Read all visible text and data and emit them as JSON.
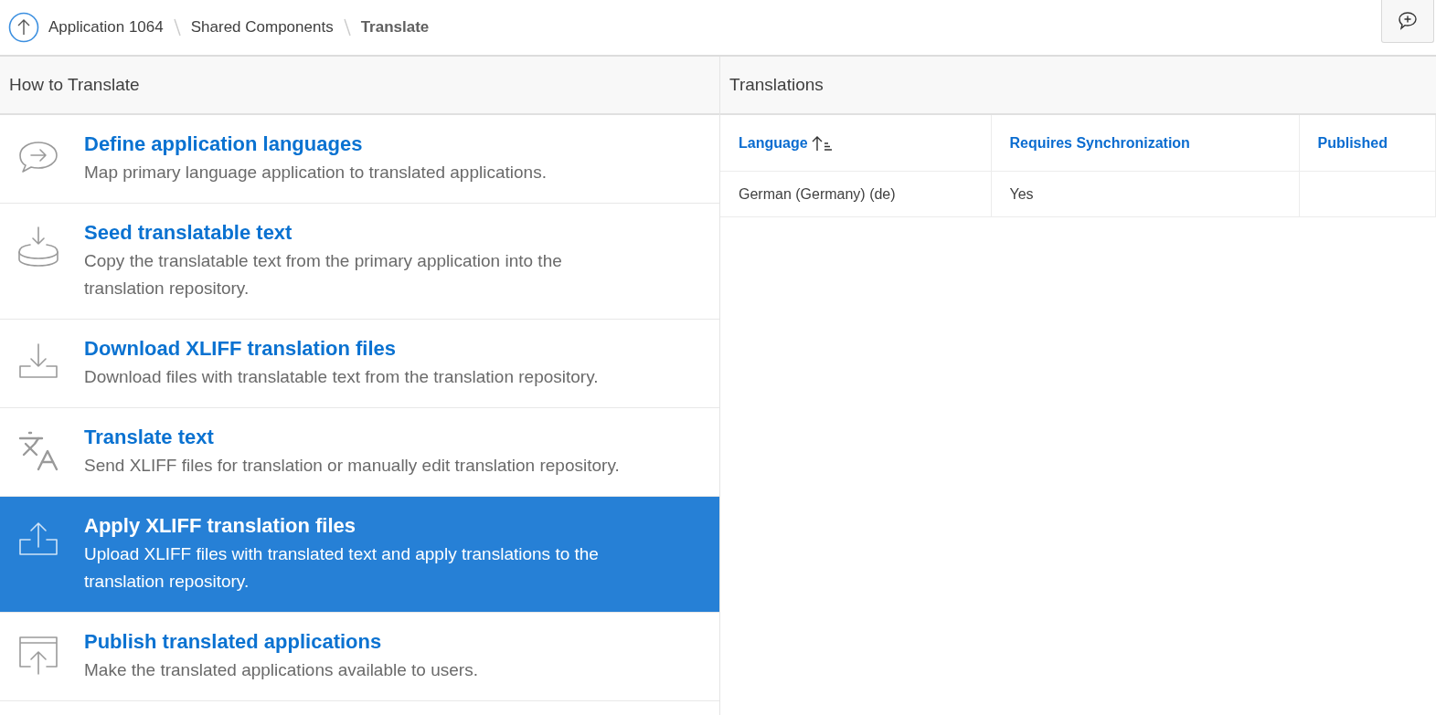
{
  "breadcrumb": {
    "items": [
      {
        "label": "Application 1064",
        "current": false
      },
      {
        "label": "Shared Components",
        "current": false
      },
      {
        "label": "Translate",
        "current": true
      }
    ]
  },
  "how_to": {
    "title": "How to Translate",
    "items": [
      {
        "kind": "chat-arrow",
        "title": "Define application languages",
        "description": "Map primary language application to translated applications.",
        "selected": false
      },
      {
        "kind": "disk-download",
        "title": "Seed translatable text",
        "description": "Copy the translatable text from the primary application into the translation repository.",
        "selected": false
      },
      {
        "kind": "tray-download",
        "title": "Download XLIFF translation files",
        "description": "Download files with translatable text from the translation repository.",
        "selected": false
      },
      {
        "kind": "translate",
        "title": "Translate text",
        "description": "Send XLIFF files for translation or manually edit translation repository.",
        "selected": false
      },
      {
        "kind": "tray-upload",
        "title": "Apply XLIFF translation files",
        "description": "Upload XLIFF files with translated text and apply translations to the translation repository.",
        "selected": true
      },
      {
        "kind": "window-upload",
        "title": "Publish translated applications",
        "description": "Make the translated applications available to users.",
        "selected": false
      }
    ]
  },
  "translations": {
    "title": "Translations",
    "columns": [
      {
        "label": "Language",
        "sorted": true
      },
      {
        "label": "Requires Synchronization",
        "sorted": false
      },
      {
        "label": "Published",
        "sorted": false
      }
    ],
    "rows": [
      [
        "German (Germany) (de)",
        "Yes",
        ""
      ]
    ]
  }
}
